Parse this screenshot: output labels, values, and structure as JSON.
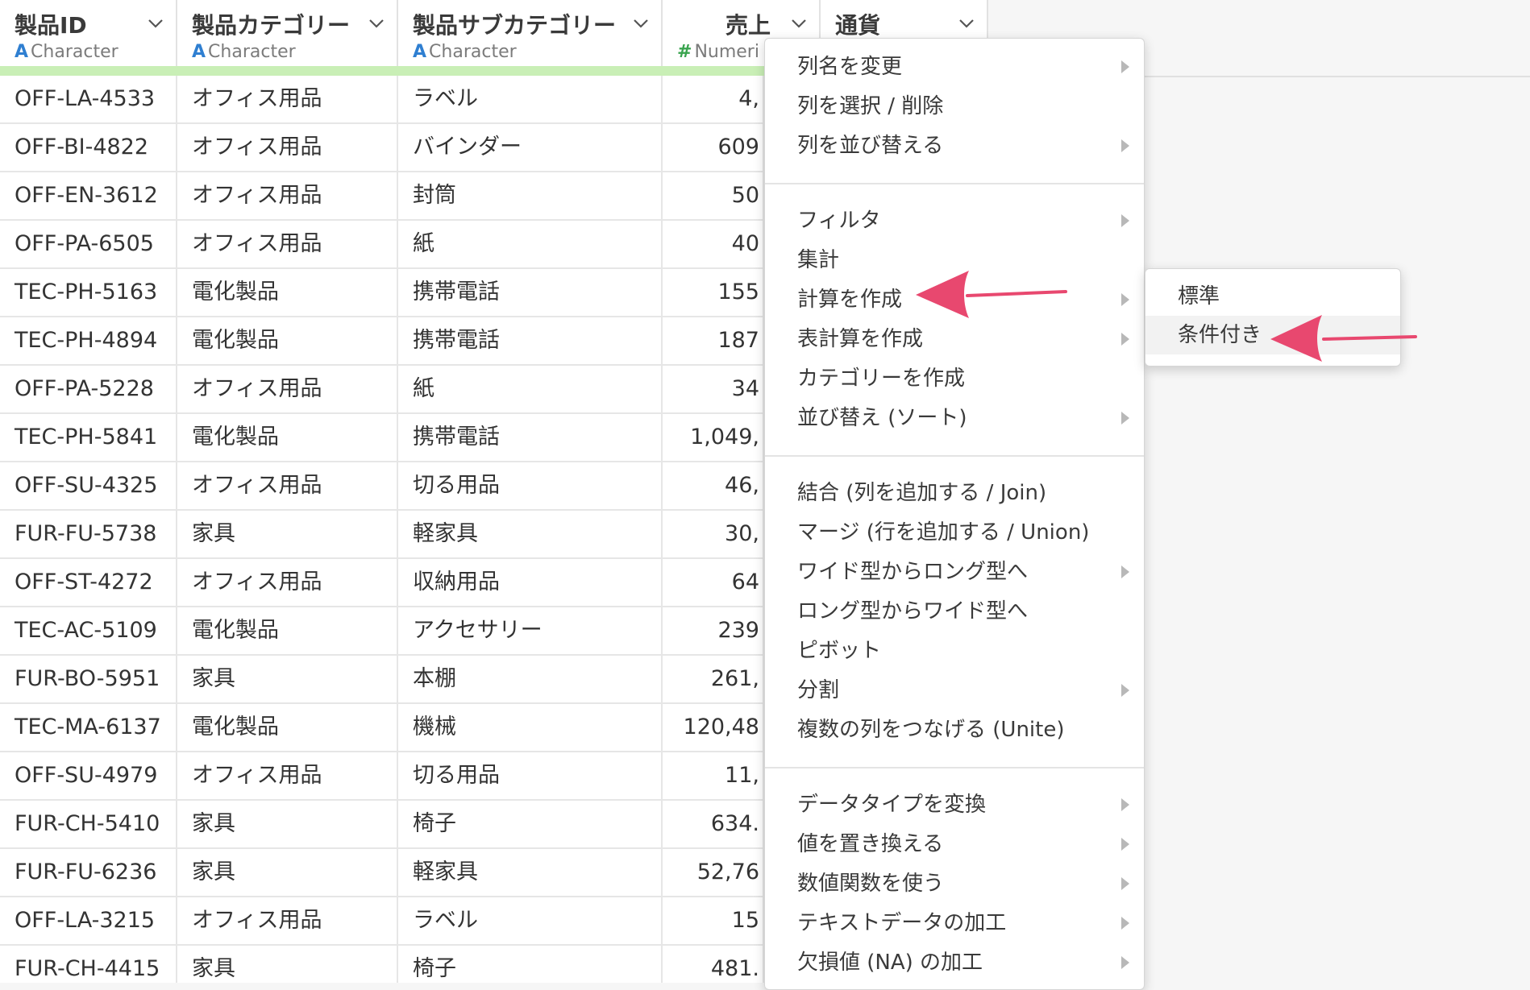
{
  "columns": [
    {
      "name": "製品ID",
      "type_glyph": "A",
      "type": "Character"
    },
    {
      "name": "製品カテゴリー",
      "type_glyph": "A",
      "type": "Character"
    },
    {
      "name": "製品サブカテゴリー",
      "type_glyph": "A",
      "type": "Character"
    },
    {
      "name": "売上",
      "type_glyph": "#",
      "type": "Numeri"
    },
    {
      "name": "通貨",
      "type_glyph": "",
      "type": ""
    }
  ],
  "rows": [
    [
      "OFF-LA-4533",
      "オフィス用品",
      "ラベル",
      "4,"
    ],
    [
      "OFF-BI-4822",
      "オフィス用品",
      "バインダー",
      "609"
    ],
    [
      "OFF-EN-3612",
      "オフィス用品",
      "封筒",
      "50"
    ],
    [
      "OFF-PA-6505",
      "オフィス用品",
      "紙",
      "40"
    ],
    [
      "TEC-PH-5163",
      "電化製品",
      "携帯電話",
      "155"
    ],
    [
      "TEC-PH-4894",
      "電化製品",
      "携帯電話",
      "187"
    ],
    [
      "OFF-PA-5228",
      "オフィス用品",
      "紙",
      "34"
    ],
    [
      "TEC-PH-5841",
      "電化製品",
      "携帯電話",
      "1,049,"
    ],
    [
      "OFF-SU-4325",
      "オフィス用品",
      "切る用品",
      "46,"
    ],
    [
      "FUR-FU-5738",
      "家具",
      "軽家具",
      "30,"
    ],
    [
      "OFF-ST-4272",
      "オフィス用品",
      "収納用品",
      "64"
    ],
    [
      "TEC-AC-5109",
      "電化製品",
      "アクセサリー",
      "239"
    ],
    [
      "FUR-BO-5951",
      "家具",
      "本棚",
      "261,"
    ],
    [
      "TEC-MA-6137",
      "電化製品",
      "機械",
      "120,48"
    ],
    [
      "OFF-SU-4979",
      "オフィス用品",
      "切る用品",
      "11,"
    ],
    [
      "FUR-CH-5410",
      "家具",
      "椅子",
      "634."
    ],
    [
      "FUR-FU-6236",
      "家具",
      "軽家具",
      "52,76"
    ],
    [
      "OFF-LA-3215",
      "オフィス用品",
      "ラベル",
      "15"
    ],
    [
      "FUR-CH-4415",
      "家具",
      "椅子",
      "481."
    ]
  ],
  "menu": {
    "groups": [
      [
        {
          "label": "列名を変更",
          "submenu": true
        },
        {
          "label": "列を選択 / 削除",
          "submenu": false
        },
        {
          "label": "列を並び替える",
          "submenu": true
        }
      ],
      [
        {
          "label": "フィルタ",
          "submenu": true
        },
        {
          "label": "集計",
          "submenu": false
        },
        {
          "label": "計算を作成",
          "submenu": true
        },
        {
          "label": "表計算を作成",
          "submenu": true
        },
        {
          "label": "カテゴリーを作成",
          "submenu": false
        },
        {
          "label": "並び替え (ソート)",
          "submenu": true
        }
      ],
      [
        {
          "label": "結合 (列を追加する / Join)",
          "submenu": false
        },
        {
          "label": "マージ (行を追加する / Union)",
          "submenu": false
        },
        {
          "label": "ワイド型からロング型へ",
          "submenu": true
        },
        {
          "label": "ロング型からワイド型へ",
          "submenu": false
        },
        {
          "label": "ピボット",
          "submenu": false
        },
        {
          "label": "分割",
          "submenu": true
        },
        {
          "label": "複数の列をつなげる (Unite)",
          "submenu": false
        }
      ],
      [
        {
          "label": "データタイプを変換",
          "submenu": true
        },
        {
          "label": "値を置き換える",
          "submenu": true
        },
        {
          "label": "数値関数を使う",
          "submenu": true
        },
        {
          "label": "テキストデータの加工",
          "submenu": true
        },
        {
          "label": "欠損値 (NA) の加工",
          "submenu": true
        }
      ]
    ]
  },
  "submenu": {
    "items": [
      {
        "label": "標準"
      },
      {
        "label": "条件付き"
      }
    ]
  },
  "colors": {
    "highlight_arrow": "#e8486f",
    "green_bar": "#c9efb6",
    "char_type": "#2f7fd1",
    "num_type": "#3aa44f"
  }
}
